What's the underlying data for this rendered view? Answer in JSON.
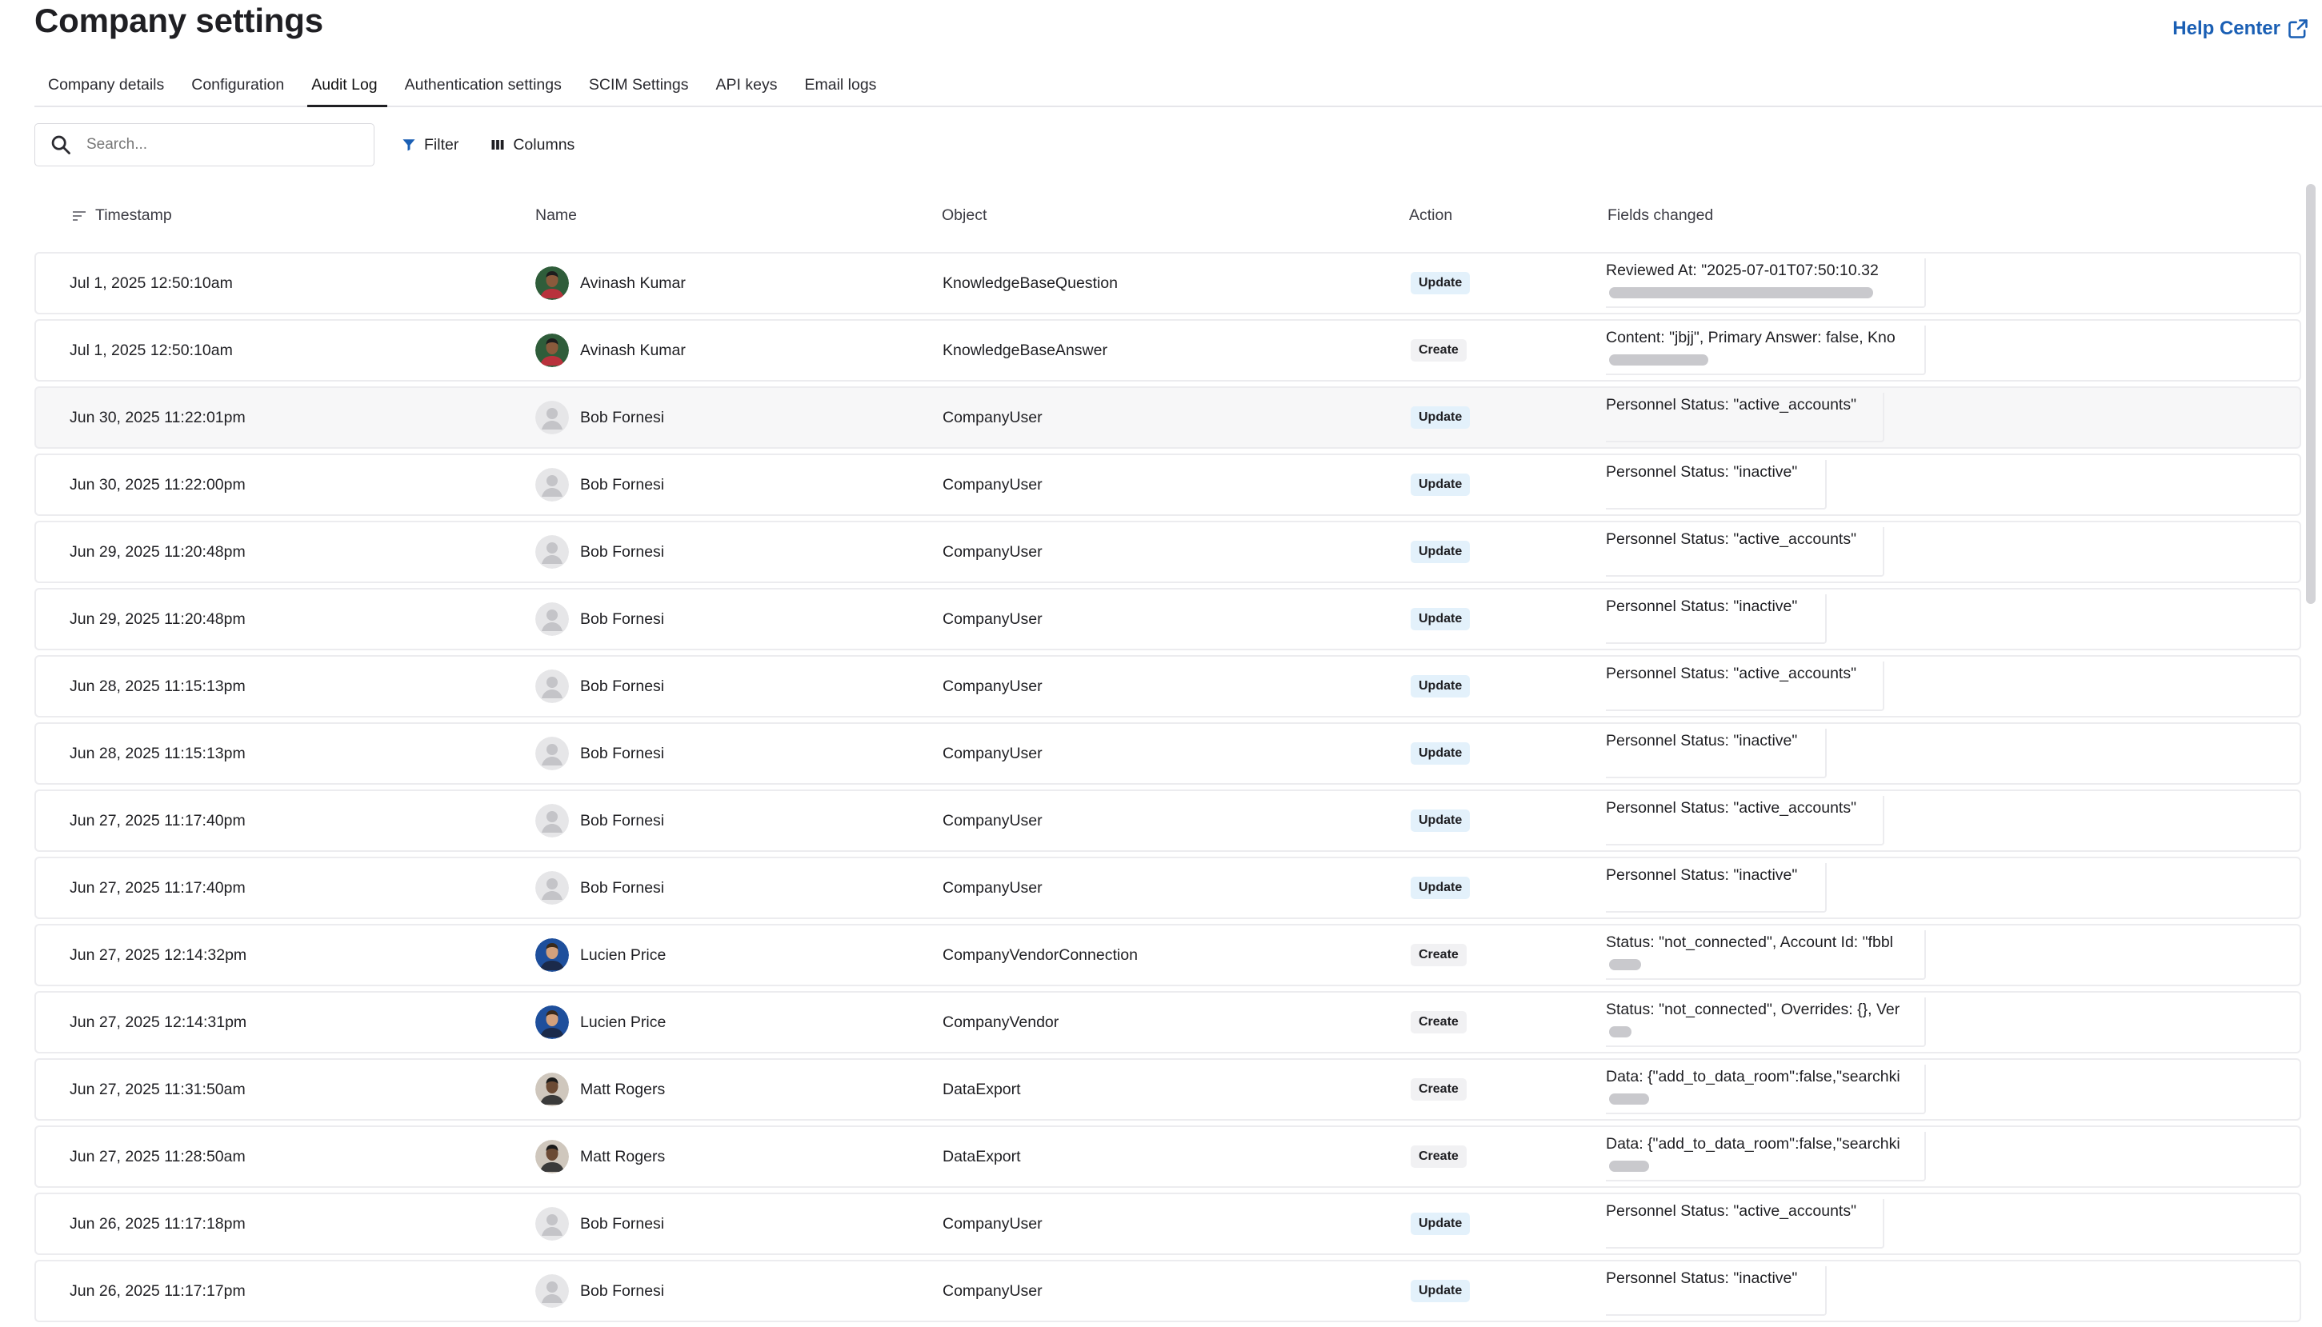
{
  "page": {
    "title": "Company settings",
    "help_center": "Help Center"
  },
  "tabs": [
    {
      "label": "Company details"
    },
    {
      "label": "Configuration"
    },
    {
      "label": "Audit Log",
      "active": true
    },
    {
      "label": "Authentication settings"
    },
    {
      "label": "SCIM Settings"
    },
    {
      "label": "API keys"
    },
    {
      "label": "Email logs"
    }
  ],
  "toolbar": {
    "search_placeholder": "Search...",
    "filter_label": "Filter",
    "columns_label": "Columns"
  },
  "table": {
    "headers": {
      "timestamp": "Timestamp",
      "name": "Name",
      "object": "Object",
      "action": "Action",
      "fields": "Fields changed"
    },
    "rows": [
      {
        "timestamp": "Jul 1, 2025 12:50:10am",
        "name": "Avinash Kumar",
        "avatar": "avinash",
        "object": "KnowledgeBaseQuestion",
        "action": "Update",
        "fields": "Reviewed At: \"2025-07-01T07:50:10.32",
        "scroll": "long"
      },
      {
        "timestamp": "Jul 1, 2025 12:50:10am",
        "name": "Avinash Kumar",
        "avatar": "avinash",
        "object": "KnowledgeBaseAnswer",
        "action": "Create",
        "fields": "Content: \"jbjj\", Primary Answer: false, Kno",
        "scroll": "med"
      },
      {
        "timestamp": "Jun 30, 2025 11:22:01pm",
        "name": "Bob Fornesi",
        "avatar": "default",
        "object": "CompanyUser",
        "action": "Update",
        "fields": "Personnel Status: \"active_accounts\"",
        "scroll": "none",
        "box": "wide",
        "highlight": true
      },
      {
        "timestamp": "Jun 30, 2025 11:22:00pm",
        "name": "Bob Fornesi",
        "avatar": "default",
        "object": "CompanyUser",
        "action": "Update",
        "fields": "Personnel Status: \"inactive\"",
        "scroll": "none",
        "box": "narrow"
      },
      {
        "timestamp": "Jun 29, 2025 11:20:48pm",
        "name": "Bob Fornesi",
        "avatar": "default",
        "object": "CompanyUser",
        "action": "Update",
        "fields": "Personnel Status: \"active_accounts\"",
        "scroll": "none",
        "box": "wide"
      },
      {
        "timestamp": "Jun 29, 2025 11:20:48pm",
        "name": "Bob Fornesi",
        "avatar": "default",
        "object": "CompanyUser",
        "action": "Update",
        "fields": "Personnel Status: \"inactive\"",
        "scroll": "none",
        "box": "narrow"
      },
      {
        "timestamp": "Jun 28, 2025 11:15:13pm",
        "name": "Bob Fornesi",
        "avatar": "default",
        "object": "CompanyUser",
        "action": "Update",
        "fields": "Personnel Status: \"active_accounts\"",
        "scroll": "none",
        "box": "wide"
      },
      {
        "timestamp": "Jun 28, 2025 11:15:13pm",
        "name": "Bob Fornesi",
        "avatar": "default",
        "object": "CompanyUser",
        "action": "Update",
        "fields": "Personnel Status: \"inactive\"",
        "scroll": "none",
        "box": "narrow"
      },
      {
        "timestamp": "Jun 27, 2025 11:17:40pm",
        "name": "Bob Fornesi",
        "avatar": "default",
        "object": "CompanyUser",
        "action": "Update",
        "fields": "Personnel Status: \"active_accounts\"",
        "scroll": "none",
        "box": "wide"
      },
      {
        "timestamp": "Jun 27, 2025 11:17:40pm",
        "name": "Bob Fornesi",
        "avatar": "default",
        "object": "CompanyUser",
        "action": "Update",
        "fields": "Personnel Status: \"inactive\"",
        "scroll": "none",
        "box": "narrow"
      },
      {
        "timestamp": "Jun 27, 2025 12:14:32pm",
        "name": "Lucien Price",
        "avatar": "lucien",
        "object": "CompanyVendorConnection",
        "action": "Create",
        "fields": "Status: \"not_connected\", Account Id: \"fbbl",
        "scroll": "tiny"
      },
      {
        "timestamp": "Jun 27, 2025 12:14:31pm",
        "name": "Lucien Price",
        "avatar": "lucien",
        "object": "CompanyVendor",
        "action": "Create",
        "fields": "Status: \"not_connected\", Overrides: {}, Ver",
        "scroll": "tinier"
      },
      {
        "timestamp": "Jun 27, 2025 11:31:50am",
        "name": "Matt Rogers",
        "avatar": "matt",
        "object": "DataExport",
        "action": "Create",
        "fields": "Data: {\"add_to_data_room\":false,\"searchki",
        "scroll": "small"
      },
      {
        "timestamp": "Jun 27, 2025 11:28:50am",
        "name": "Matt Rogers",
        "avatar": "matt",
        "object": "DataExport",
        "action": "Create",
        "fields": "Data: {\"add_to_data_room\":false,\"searchki",
        "scroll": "small"
      },
      {
        "timestamp": "Jun 26, 2025 11:17:18pm",
        "name": "Bob Fornesi",
        "avatar": "default",
        "object": "CompanyUser",
        "action": "Update",
        "fields": "Personnel Status: \"active_accounts\"",
        "scroll": "none",
        "box": "wide"
      },
      {
        "timestamp": "Jun 26, 2025 11:17:17pm",
        "name": "Bob Fornesi",
        "avatar": "default",
        "object": "CompanyUser",
        "action": "Update",
        "fields": "Personnel Status: \"inactive\"",
        "scroll": "none",
        "box": "narrow"
      }
    ]
  },
  "colors": {
    "link": "#1a5fb4",
    "update_badge": "#e3f1fb",
    "create_badge": "#f1f1f3",
    "row_border": "#ececef"
  }
}
